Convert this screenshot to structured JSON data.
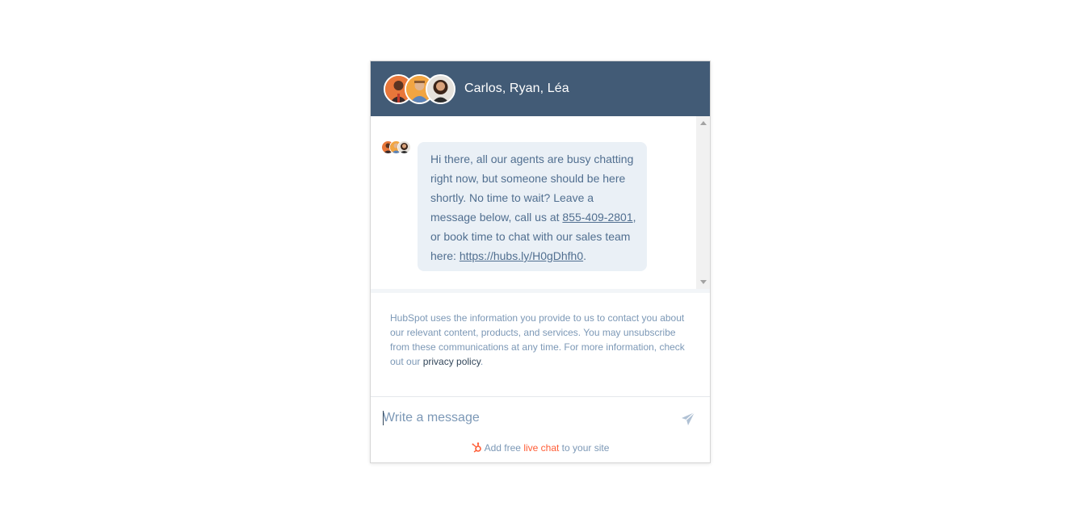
{
  "header": {
    "title": "Carlos, Ryan, Léa",
    "avatars": [
      "Carlos",
      "Ryan",
      "Léa"
    ]
  },
  "message": {
    "text_before_phone": "Hi there, all our agents are busy chatting right now, but someone should be here shortly. No time to wait? Leave a message below, call us at ",
    "phone": "855-409-2801",
    "text_middle": ", or book time to chat with our sales team here: ",
    "link": "https://hubs.ly/H0gDhfh0",
    "text_end": "."
  },
  "consent": {
    "text": "HubSpot uses the information you provide to us to contact you about our relevant content, products, and services. You may unsubscribe from these communications at any time. For more information, check out our ",
    "privacy_link": "privacy policy",
    "end": "."
  },
  "composer": {
    "placeholder": "Write a message"
  },
  "footer": {
    "prefix": "Add free ",
    "link": "live chat",
    "suffix": " to your site"
  },
  "colors": {
    "header_bg": "#425b76",
    "bubble_bg": "#eaf0f6",
    "text_muted": "#7c98b6",
    "accent": "#ff5c35"
  },
  "icons": {
    "send": "send-icon",
    "brand": "hubspot-sprocket-icon"
  }
}
